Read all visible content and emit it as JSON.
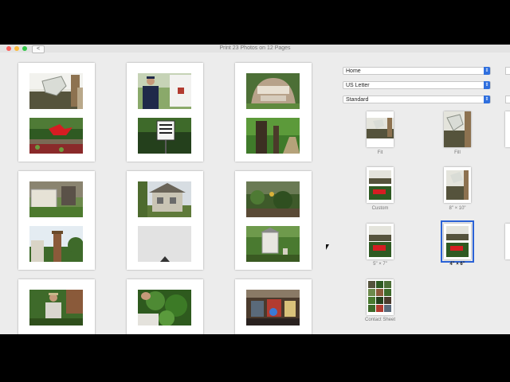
{
  "window": {
    "title": "Print 23 Photos on 12 Pages",
    "back_label": "<"
  },
  "settings": {
    "printer": "Home",
    "paper": "US Letter",
    "quality": "Standard"
  },
  "print_sizes": [
    {
      "label": "Fit",
      "selected": false
    },
    {
      "label": "Fill",
      "selected": false
    },
    {
      "label": "Custom",
      "selected": false
    },
    {
      "label": "8\" × 10\"",
      "selected": false
    },
    {
      "label": "5\" × 7\"",
      "selected": false
    },
    {
      "label": "4\" × 6\"",
      "selected": true
    },
    {
      "label": "Contact Sheet",
      "selected": false
    }
  ],
  "pages": [
    {
      "top": "horse sculpture",
      "bottom": "red bird sculpture"
    },
    {
      "top": "man by truck",
      "bottom": "no dumping sign"
    },
    {
      "top": "welcome sign",
      "bottom": "tree trunk path"
    },
    {
      "top": "pillar in garden",
      "bottom": "brick tower"
    },
    {
      "top": "stone house",
      "bottom": "blank frame"
    },
    {
      "top": "overgrown garden",
      "bottom": "garden shed"
    },
    {
      "top": "man in hat",
      "bottom": "hands in leaves"
    },
    {
      "top": "hardware store",
      "bottom": ""
    }
  ],
  "colors": {
    "accent": "#2a62d6",
    "background": "#ececec"
  }
}
